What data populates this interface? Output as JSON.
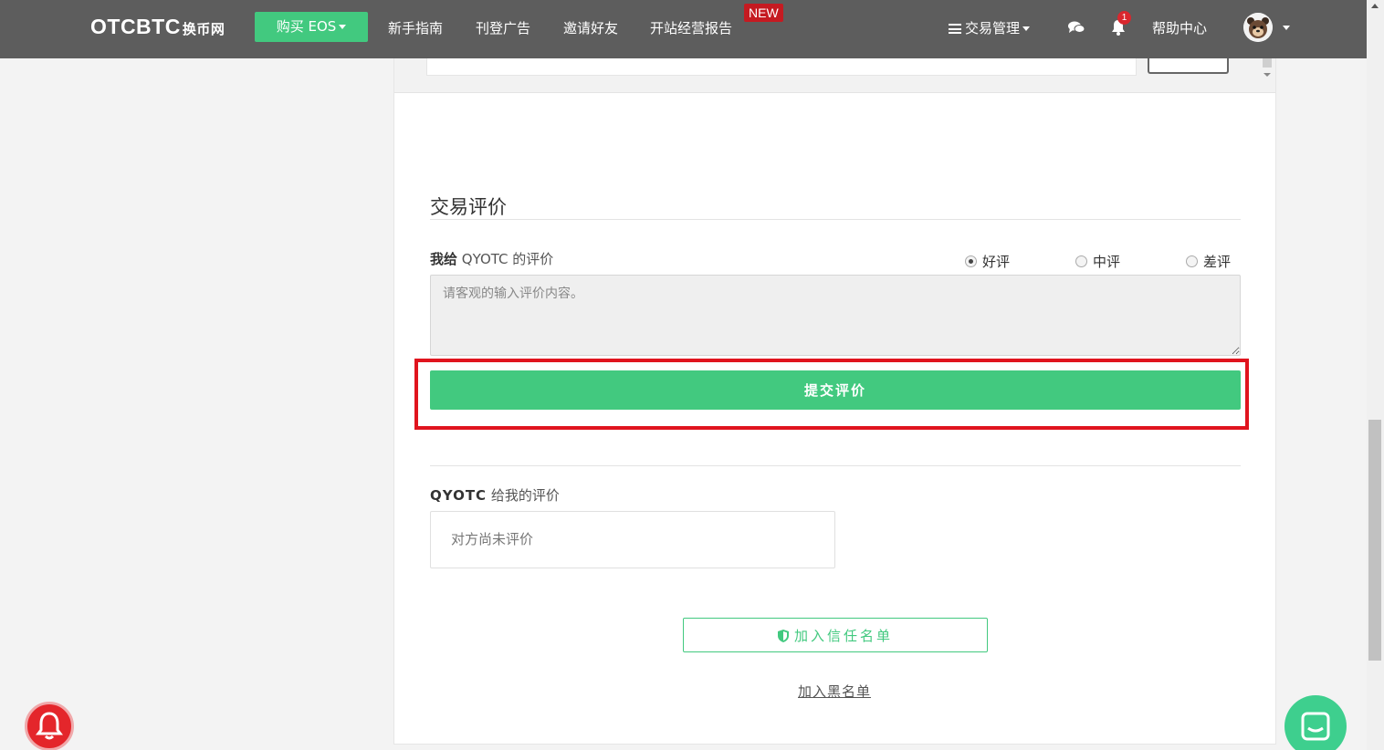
{
  "navbar": {
    "brand": "OTCBTC",
    "brand_sub": "换币网",
    "buy_button": "购买 EOS",
    "items": [
      {
        "label": "新手指南"
      },
      {
        "label": "刊登广告"
      },
      {
        "label": "邀请好友"
      },
      {
        "label": "开站经营报告"
      }
    ],
    "new_badge": "NEW",
    "trade_management": "交易管理",
    "notification_count": "1",
    "help_center": "帮助中心"
  },
  "rating": {
    "section_title": "交易评价",
    "my_rating_prefix": "我给",
    "my_rating_suffix": "QYOTC 的评价",
    "options": [
      {
        "label": "好评",
        "selected": true
      },
      {
        "label": "中评",
        "selected": false
      },
      {
        "label": "差评",
        "selected": false
      }
    ],
    "textarea_placeholder": "请客观的输入评价内容。",
    "submit_label": "提交评价",
    "their_rating_name": "QYOTC",
    "their_rating_suffix": "给我的评价",
    "their_rating_value": "对方尚未评价",
    "trust_label": "加入信任名单",
    "blacklist_label": "加入黑名单"
  },
  "colors": {
    "navbar_bg": "#5d5d5d",
    "accent_green": "#42c97f",
    "highlight_red": "#e0141e",
    "badge_red": "#c51a21"
  },
  "icons": [
    "list-icon",
    "chat-bubbles-icon",
    "bell-icon",
    "avatar-icon",
    "shield-icon",
    "notification-bell-icon",
    "chat-widget-icon"
  ]
}
